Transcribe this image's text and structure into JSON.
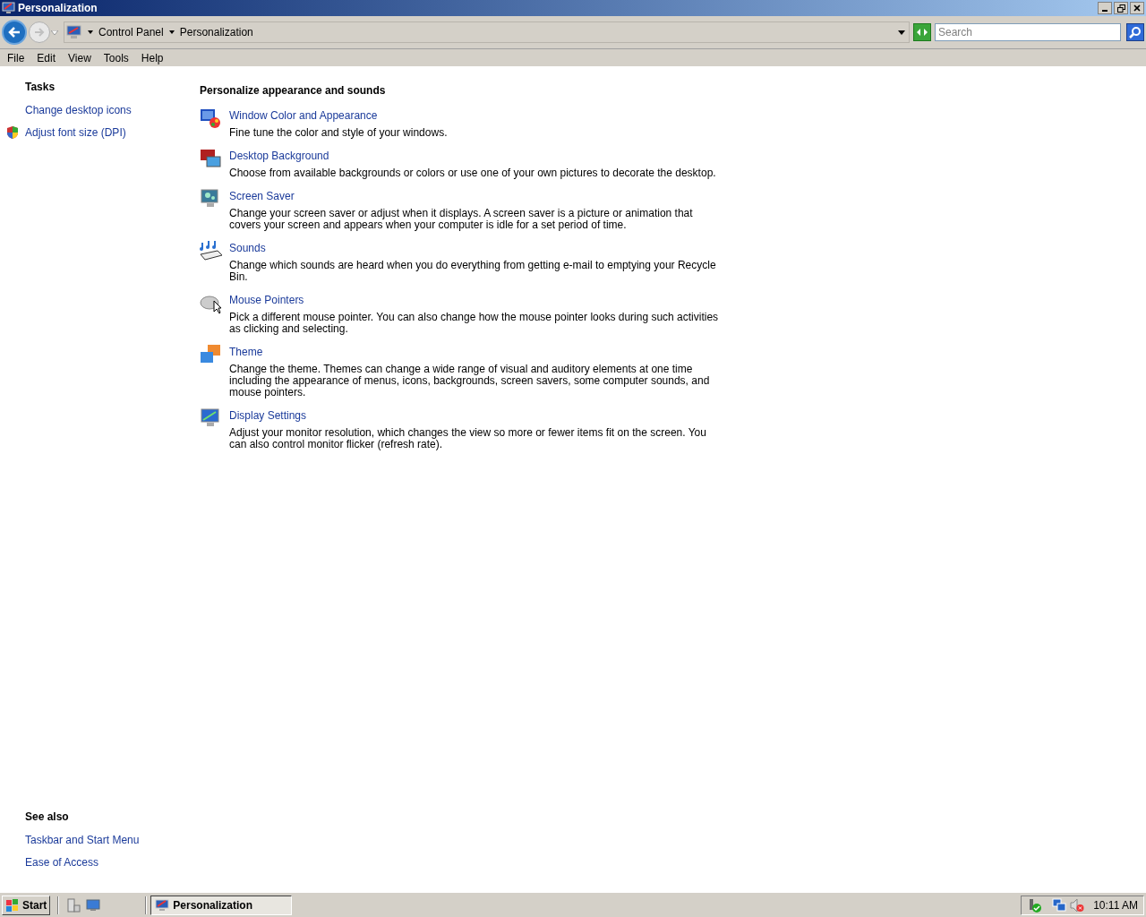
{
  "window": {
    "title": "Personalization"
  },
  "address_bar": {
    "breadcrumbs": [
      "Control Panel",
      "Personalization"
    ],
    "search": {
      "placeholder": "Search"
    }
  },
  "menu_bar": [
    "File",
    "Edit",
    "View",
    "Tools",
    "Help"
  ],
  "sidebar": {
    "tasks_heading": "Tasks",
    "tasks": [
      {
        "label": "Change desktop icons",
        "kind": "plain"
      },
      {
        "label": "Adjust font size (DPI)",
        "kind": "shield"
      }
    ],
    "see_also_heading": "See also",
    "see_also": [
      "Taskbar and Start Menu",
      "Ease of Access"
    ]
  },
  "content": {
    "heading": "Personalize appearance and sounds",
    "items": [
      {
        "title": "Window Color and Appearance",
        "description": "Fine tune the color and style of your windows."
      },
      {
        "title": "Desktop Background",
        "description": "Choose from available backgrounds or colors or use one of your own pictures to decorate the desktop."
      },
      {
        "title": "Screen Saver",
        "description": "Change your screen saver or adjust when it displays. A screen saver is a picture or animation that covers your screen and appears when your computer is idle for a set period of time."
      },
      {
        "title": "Sounds",
        "description": "Change which sounds are heard when you do everything from getting e-mail to emptying your Recycle Bin."
      },
      {
        "title": "Mouse Pointers",
        "description": "Pick a different mouse pointer. You can also change how the mouse pointer looks during such activities as clicking and selecting."
      },
      {
        "title": "Theme",
        "description": "Change the theme. Themes can change a wide range of visual and auditory elements at one time including the appearance of menus, icons, backgrounds, screen savers, some computer sounds, and mouse pointers."
      },
      {
        "title": "Display Settings",
        "description": "Adjust your monitor resolution, which changes the view so more or fewer items fit on the screen. You can also control monitor flicker (refresh rate)."
      }
    ]
  },
  "taskbar": {
    "start": "Start",
    "windows": [
      {
        "label": "Personalization",
        "selected": true
      }
    ],
    "clock": "10:11 AM"
  }
}
